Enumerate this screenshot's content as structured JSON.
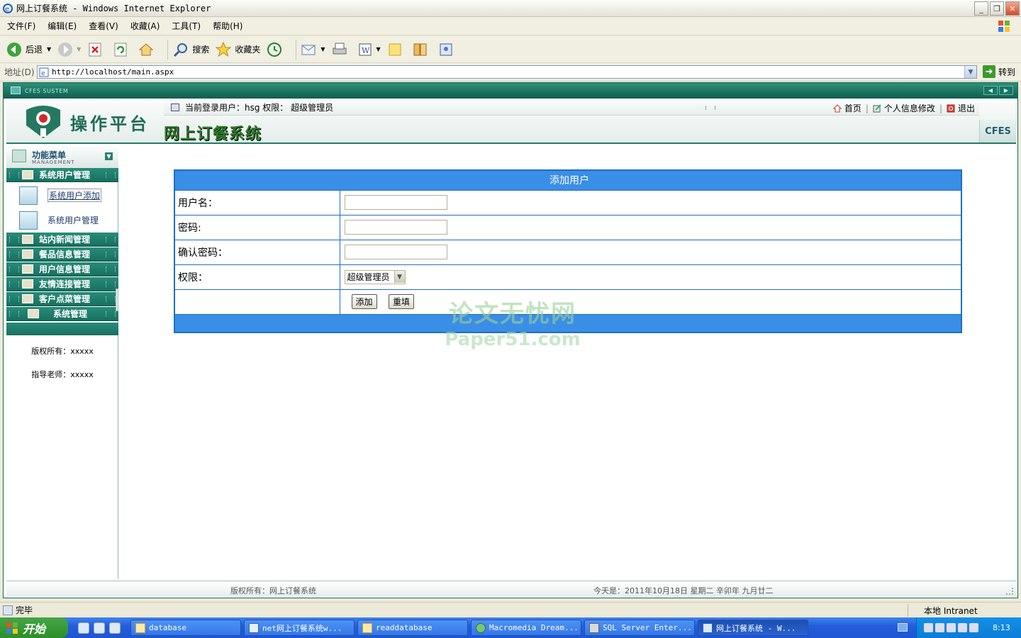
{
  "window": {
    "title": "网上订餐系统 - Windows Internet Explorer"
  },
  "menubar": [
    "文件(F)",
    "编辑(E)",
    "查看(V)",
    "收藏(A)",
    "工具(T)",
    "帮助(H)"
  ],
  "toolbar": {
    "back": "后退",
    "search": "搜索",
    "favorites": "收藏夹"
  },
  "address": {
    "label": "地址(D)",
    "url": "http://localhost/main.aspx",
    "go": "转到"
  },
  "frame": {
    "system_tag": "CFES SUSTEM"
  },
  "header": {
    "logo_text": "操作平台",
    "current_user": "当前登录用户：hsg 权限： 超级管理员",
    "nav": {
      "home": "首页",
      "profile": "个人信息修改",
      "logout": "退出"
    },
    "system_name": "网上订餐系统",
    "cfes_badge": "CFES"
  },
  "sidebar": {
    "title": "功能菜单",
    "subtitle": "MANAGEMENT",
    "section_user_mgmt": "系统用户管理",
    "sub_items": [
      "系统用户添加",
      "系统用户管理"
    ],
    "sections": [
      "站内新闻管理",
      "餐品信息管理",
      "用户信息管理",
      "友情连接管理",
      "客户点菜管理",
      "系统管理"
    ],
    "copyright": "版权所有：xxxxx",
    "advisor": "指导老师：xxxxx"
  },
  "form": {
    "title": "添加用户",
    "username_label": "用户名：",
    "password_label": "密码:",
    "confirm_label": "确认密码：",
    "role_label": "权限：",
    "role_value": "超级管理员",
    "submit": "添加",
    "reset": "重填",
    "username_value": "",
    "password_value": "",
    "confirm_value": ""
  },
  "watermark": {
    "line1": "论文无忧网",
    "line2": "Paper51.com"
  },
  "footer": {
    "copyright": "版权所有：网上订餐系统",
    "date": "今天是：2011年10月18日 星期二 辛卯年 九月廿二"
  },
  "status": {
    "text": "完毕",
    "zone": "本地 Intranet"
  },
  "taskbar": {
    "start": "开始",
    "items": [
      "database",
      "net网上订餐系统w...",
      "readdatabase",
      "Macromedia Dream...",
      "SQL Server Enter...",
      "网上订餐系统 - W..."
    ],
    "clock": "8:13"
  }
}
